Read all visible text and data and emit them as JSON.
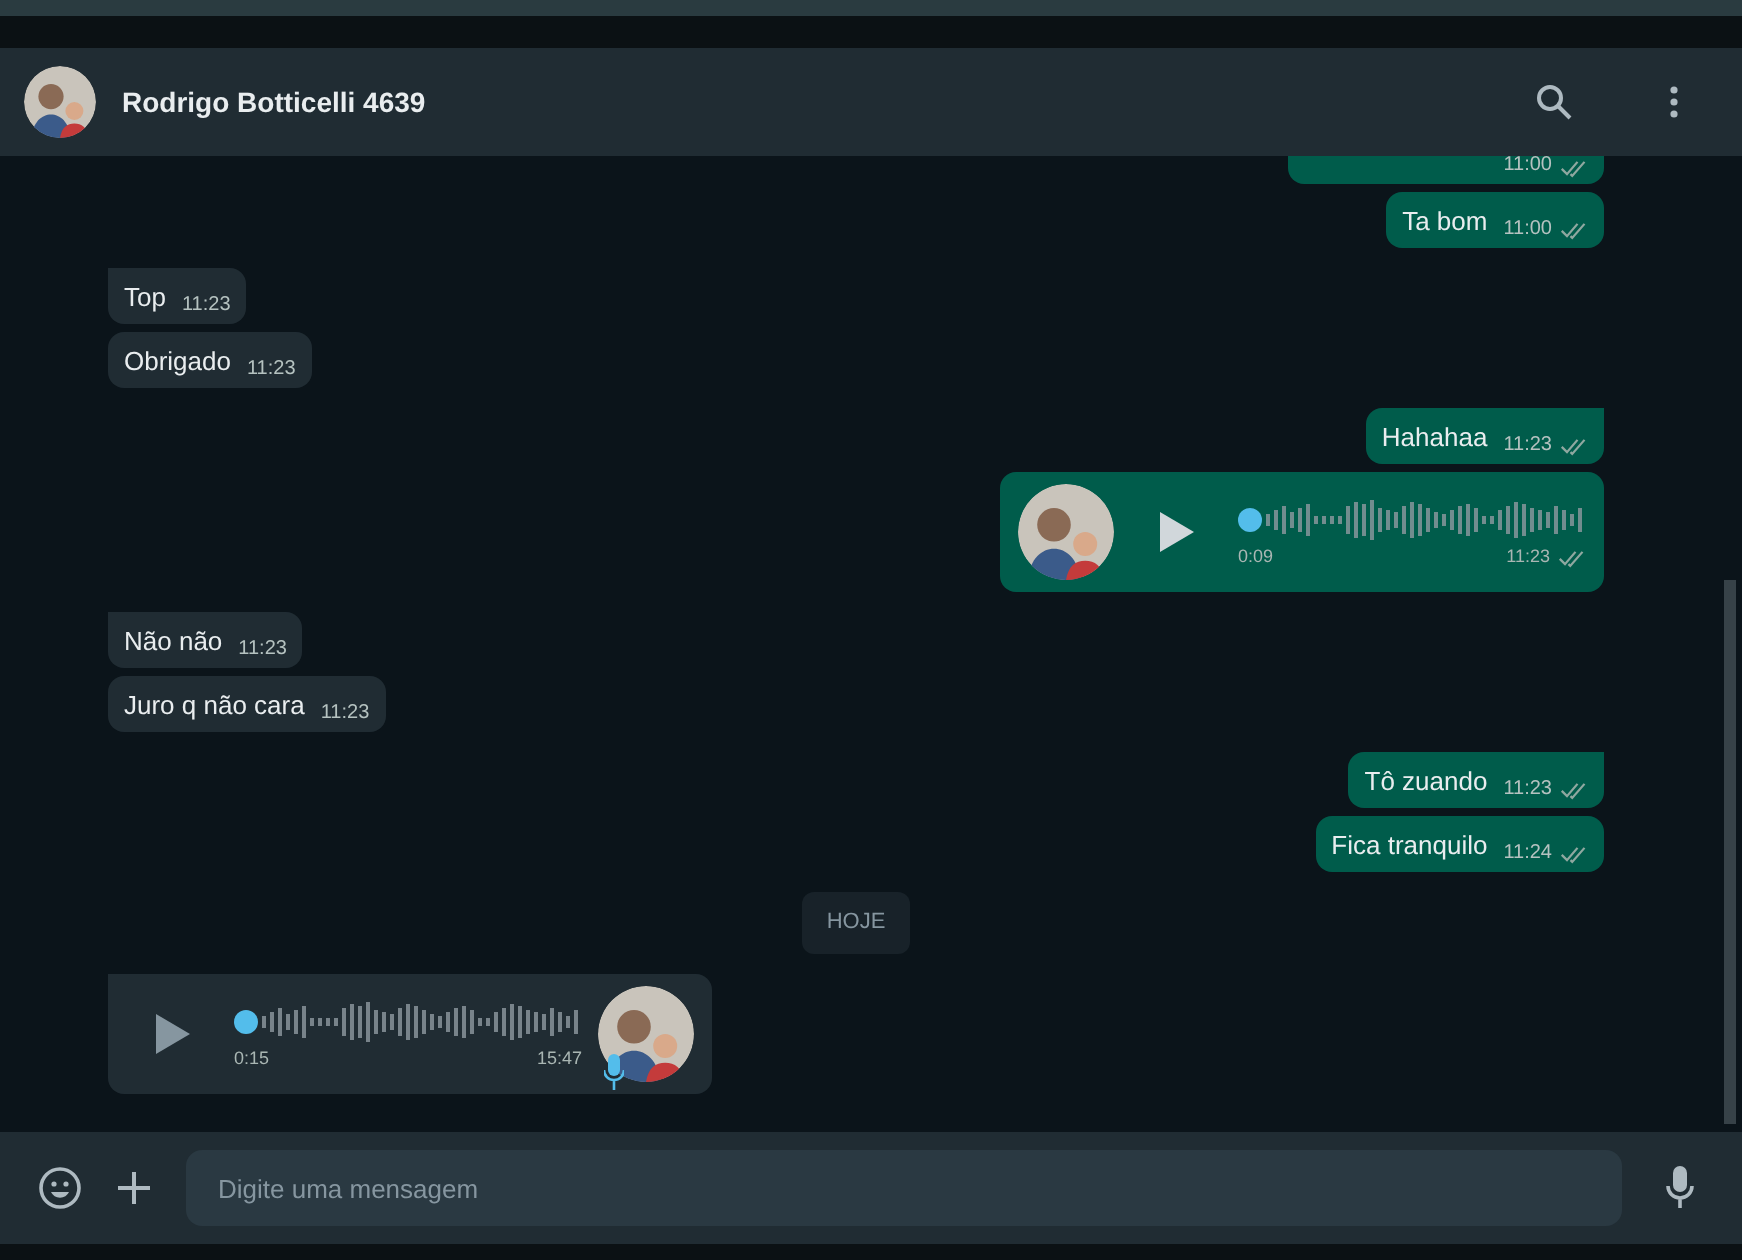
{
  "header": {
    "contact_name": "Rodrigo Botticelli 4639"
  },
  "groups": [
    {
      "outgoing": true,
      "messages": [
        {
          "kind": "cut",
          "time": "11:00",
          "read": false
        },
        {
          "kind": "text",
          "text": "Ta bom",
          "time": "11:00",
          "read": false,
          "tail": false
        }
      ]
    },
    {
      "outgoing": false,
      "messages": [
        {
          "kind": "text",
          "text": "Top",
          "time": "11:23",
          "tail": true
        },
        {
          "kind": "text",
          "text": "Obrigado",
          "time": "11:23",
          "tail": false
        }
      ]
    },
    {
      "outgoing": true,
      "messages": [
        {
          "kind": "text",
          "text": "Hahahaa",
          "time": "11:23",
          "read": false,
          "tail": true
        },
        {
          "kind": "voice",
          "position": "0:09",
          "time": "11:23",
          "read": false,
          "tail": false
        }
      ]
    },
    {
      "outgoing": false,
      "messages": [
        {
          "kind": "text",
          "text": "Não não",
          "time": "11:23",
          "tail": true
        },
        {
          "kind": "text",
          "text": "Juro q não cara",
          "time": "11:23",
          "tail": false
        }
      ]
    },
    {
      "outgoing": true,
      "messages": [
        {
          "kind": "text",
          "text": "Tô zuando",
          "time": "11:23",
          "read": false,
          "tail": true
        },
        {
          "kind": "text",
          "text": "Fica tranquilo",
          "time": "11:24",
          "read": false,
          "tail": false
        }
      ]
    },
    {
      "messages": [
        {
          "kind": "date",
          "text": "HOJE"
        }
      ]
    },
    {
      "outgoing": false,
      "messages": [
        {
          "kind": "voice",
          "position": "0:15",
          "time": "15:47",
          "tail": true
        }
      ]
    }
  ],
  "composer": {
    "placeholder": "Digite uma mensagem"
  }
}
